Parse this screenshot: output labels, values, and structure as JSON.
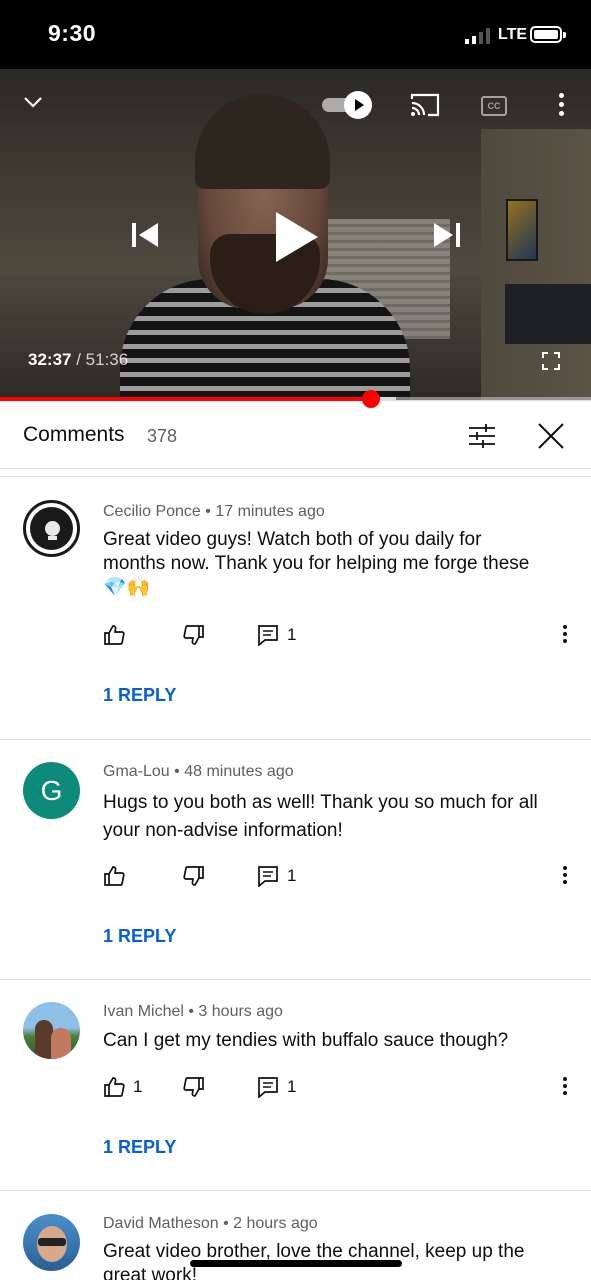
{
  "status_bar": {
    "time": "9:30",
    "network": "LTE"
  },
  "player": {
    "current_time": "32:37",
    "separator": " / ",
    "duration": "51:36",
    "progress_fraction": 0.6276,
    "buffer_fraction": 0.67,
    "accent_color": "#ff0000",
    "icons": [
      "chevron-down-icon",
      "autoplay-toggle-icon",
      "cast-icon",
      "cc-icon",
      "more-vert-icon",
      "skip-previous-icon",
      "play-icon",
      "skip-next-icon",
      "fullscreen-icon"
    ],
    "cc_label": "CC"
  },
  "comments_panel": {
    "title": "Comments",
    "count": "378",
    "icons": [
      "filter-icon",
      "close-icon"
    ],
    "comments": [
      {
        "author": "Cecilio Ponce",
        "age": "17 minutes ago",
        "text_lines": [
          "Great video guys! Watch both of you daily for",
          "months now. Thank you for helping me forge these",
          "💎🙌"
        ],
        "likes": "",
        "reply_count": "1",
        "replies_label": "1 REPLY",
        "avatar": "badge"
      },
      {
        "author": "Gma-Lou",
        "age": "48 minutes ago",
        "text_lines": [
          "Hugs to you both as well!  Thank you so much for all",
          "your non-advise information!"
        ],
        "likes": "",
        "reply_count": "1",
        "replies_label": "1 REPLY",
        "avatar_letter": "G",
        "avatar_color": "#0e8a7a"
      },
      {
        "author": "Ivan Michel",
        "age": "3 hours ago",
        "text_lines": [
          "Can I get my tendies with buffalo sauce though?"
        ],
        "likes": "1",
        "reply_count": "1",
        "replies_label": "1 REPLY",
        "avatar": "photo"
      },
      {
        "author": "David Matheson",
        "age": "2 hours ago",
        "text_lines": [
          "Great video brother, love the channel, keep up the",
          "great work!"
        ],
        "avatar": "photo"
      }
    ],
    "link_color": "#065fd4"
  }
}
